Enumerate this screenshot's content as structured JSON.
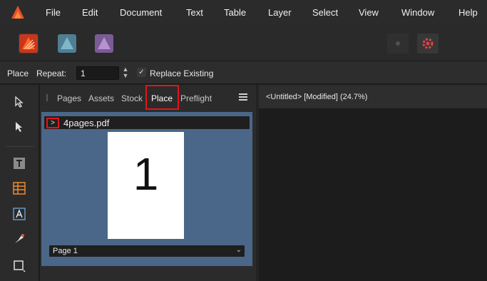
{
  "menubar": {
    "app_icon": "affinity-publisher-logo",
    "items": [
      "File",
      "Edit",
      "Document",
      "Text",
      "Table",
      "Layer",
      "Select",
      "View",
      "Window",
      "Help"
    ]
  },
  "studio": {
    "personas": [
      "publisher-persona-icon",
      "designer-persona-icon",
      "photo-persona-icon"
    ],
    "right_buttons": [
      "snapping-icon",
      "settings-gear-icon"
    ]
  },
  "context_toolbar": {
    "tool_label": "Place",
    "repeat_label": "Repeat:",
    "repeat_value": "1",
    "replace_existing_label": "Replace Existing",
    "replace_existing_checked": true
  },
  "tools": [
    "move-tool-icon",
    "node-tool-icon",
    "frame-text-tool-icon",
    "table-tool-icon",
    "artistic-text-tool-icon",
    "pen-tool-icon",
    "rectangle-tool-icon"
  ],
  "panel": {
    "tabs": [
      "Pages",
      "Assets",
      "Stock",
      "Place",
      "Preflight"
    ],
    "active_tab": "Place",
    "file_expand_glyph": ">",
    "file_name": "4pages.pdf",
    "page_preview_number": "1",
    "page_select_value": "Page 1"
  },
  "document": {
    "title": "<Untitled> [Modified] (24.7%)"
  },
  "colors": {
    "accent_red": "#e4141b",
    "place_bg": "#4a6789"
  }
}
